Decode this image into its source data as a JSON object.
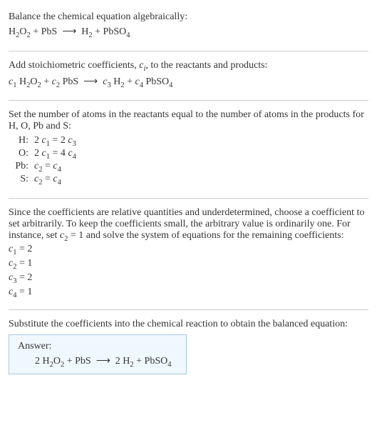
{
  "section1": {
    "title": "Balance the chemical equation algebraically:",
    "equation_html": "H<sub>2</sub>O<sub>2</sub> + PbS &nbsp;⟶&nbsp; H<sub>2</sub> + PbSO<sub>4</sub>"
  },
  "section2": {
    "title_html": "Add stoichiometric coefficients, <span class='italic'>c<sub>i</sub></span>, to the reactants and products:",
    "equation_html": "<span class='italic'>c</span><sub>1</sub> H<sub>2</sub>O<sub>2</sub> + <span class='italic'>c</span><sub>2</sub> PbS &nbsp;⟶&nbsp; <span class='italic'>c</span><sub>3</sub> H<sub>2</sub> + <span class='italic'>c</span><sub>4</sub> PbSO<sub>4</sub>"
  },
  "section3": {
    "title": "Set the number of atoms in the reactants equal to the number of atoms in the products for H, O, Pb and S:",
    "rows": [
      {
        "label": "H:",
        "eq_html": "2 <span class='italic'>c</span><sub>1</sub> = 2 <span class='italic'>c</span><sub>3</sub>"
      },
      {
        "label": "O:",
        "eq_html": "2 <span class='italic'>c</span><sub>1</sub> = 4 <span class='italic'>c</span><sub>4</sub>"
      },
      {
        "label": "Pb:",
        "eq_html": "<span class='italic'>c</span><sub>2</sub> = <span class='italic'>c</span><sub>4</sub>"
      },
      {
        "label": "S:",
        "eq_html": "<span class='italic'>c</span><sub>2</sub> = <span class='italic'>c</span><sub>4</sub>"
      }
    ]
  },
  "section4": {
    "title_html": "Since the coefficients are relative quantities and underdetermined, choose a coefficient to set arbitrarily. To keep the coefficients small, the arbitrary value is ordinarily one. For instance, set <span class='italic'>c</span><sub>2</sub> = 1 and solve the system of equations for the remaining coefficients:",
    "coefs": [
      {
        "html": "<span class='italic'>c</span><sub>1</sub> = 2"
      },
      {
        "html": "<span class='italic'>c</span><sub>2</sub> = 1"
      },
      {
        "html": "<span class='italic'>c</span><sub>3</sub> = 2"
      },
      {
        "html": "<span class='italic'>c</span><sub>4</sub> = 1"
      }
    ]
  },
  "section5": {
    "title": "Substitute the coefficients into the chemical reaction to obtain the balanced equation:",
    "answer_label": "Answer:",
    "answer_html": "2 H<sub>2</sub>O<sub>2</sub> + PbS &nbsp;⟶&nbsp; 2 H<sub>2</sub> + PbSO<sub>4</sub>"
  }
}
